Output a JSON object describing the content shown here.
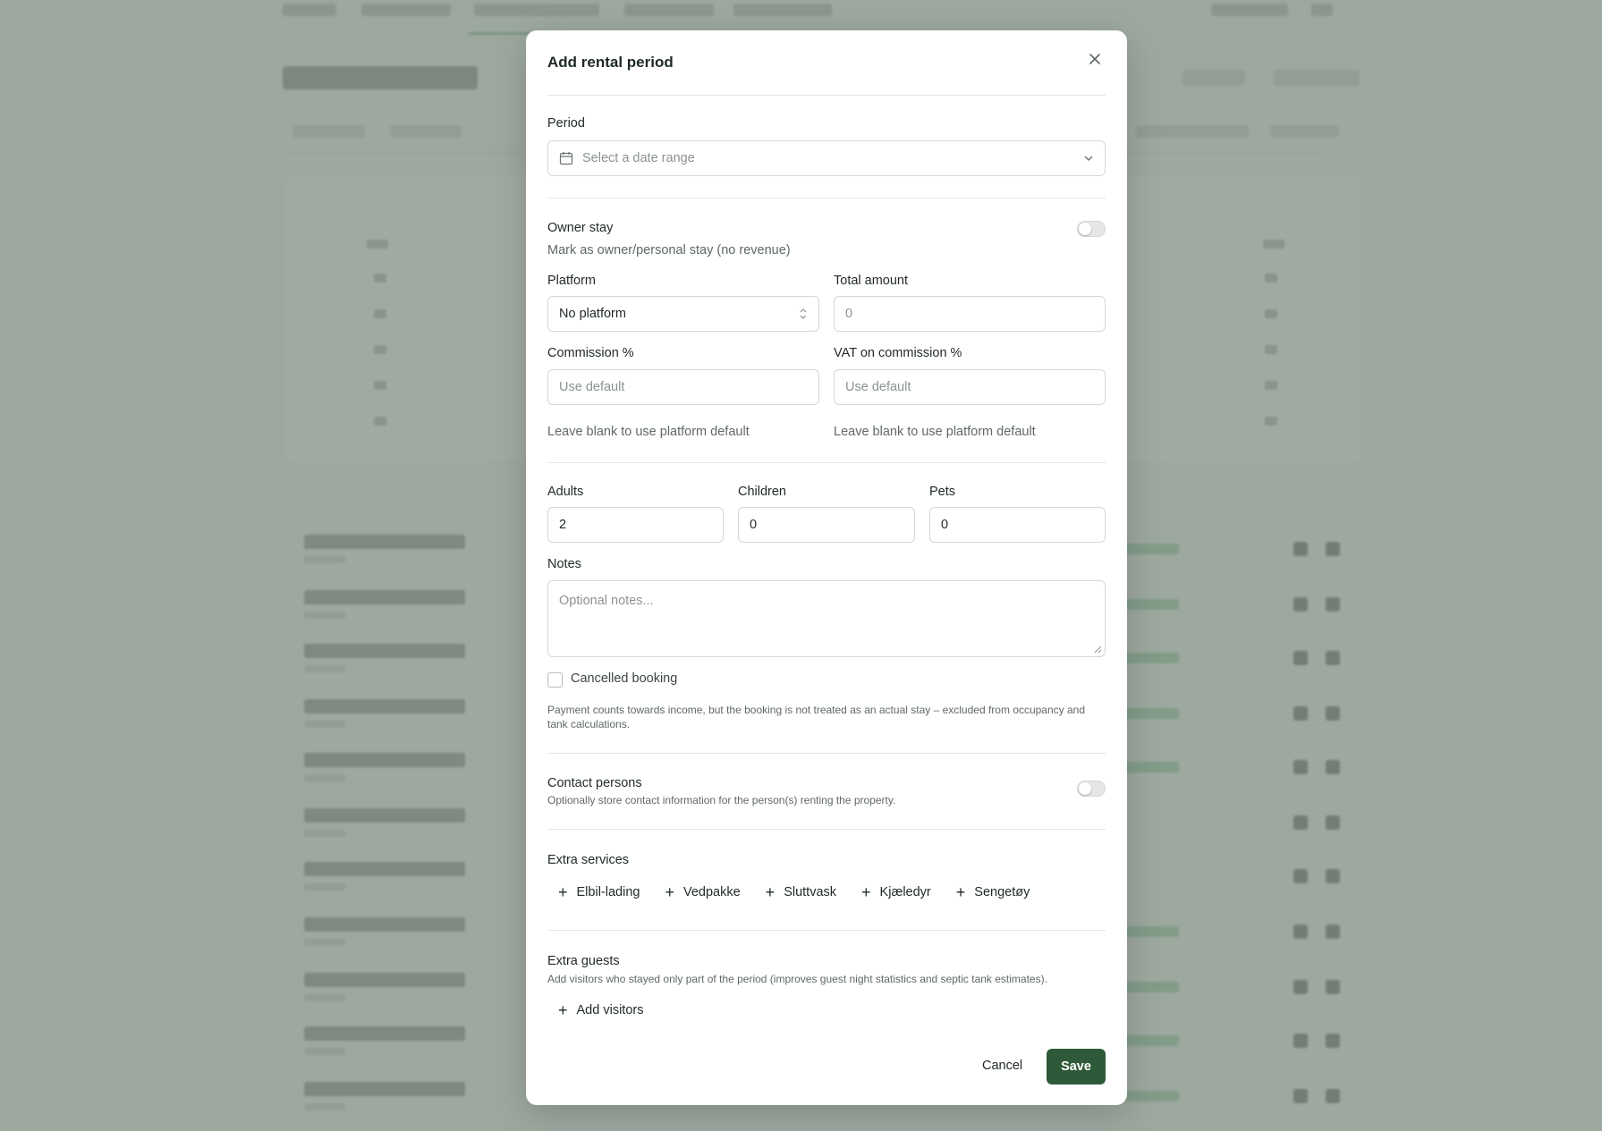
{
  "modal": {
    "title": "Add rental period",
    "period": {
      "label": "Period",
      "placeholder": "Select a date range"
    },
    "owner_stay": {
      "label": "Owner stay",
      "description": "Mark as owner/personal stay (no revenue)"
    },
    "platform": {
      "label": "Platform",
      "value": "No platform"
    },
    "total_amount": {
      "label": "Total amount",
      "placeholder": "0"
    },
    "commission": {
      "label": "Commission %",
      "placeholder": "Use default",
      "help": "Leave blank to use platform default"
    },
    "vat_commission": {
      "label": "VAT on commission %",
      "placeholder": "Use default",
      "help": "Leave blank to use platform default"
    },
    "adults": {
      "label": "Adults",
      "value": "2"
    },
    "children": {
      "label": "Children",
      "value": "0"
    },
    "pets": {
      "label": "Pets",
      "value": "0"
    },
    "notes": {
      "label": "Notes",
      "placeholder": "Optional notes..."
    },
    "cancelled": {
      "label": "Cancelled booking",
      "description": "Payment counts towards income, but the booking is not treated as an actual stay – excluded from occupancy and tank calculations."
    },
    "contact_persons": {
      "label": "Contact persons",
      "description": "Optionally store contact information for the person(s) renting the property."
    },
    "extra_services": {
      "label": "Extra services",
      "items": [
        "Elbil-lading",
        "Vedpakke",
        "Sluttvask",
        "Kjæledyr",
        "Sengetøy"
      ]
    },
    "extra_guests": {
      "label": "Extra guests",
      "description": "Add visitors who stayed only part of the period (improves guest night statistics and septic tank estimates).",
      "add_label": "Add visitors"
    },
    "actions": {
      "cancel": "Cancel",
      "save": "Save"
    }
  }
}
